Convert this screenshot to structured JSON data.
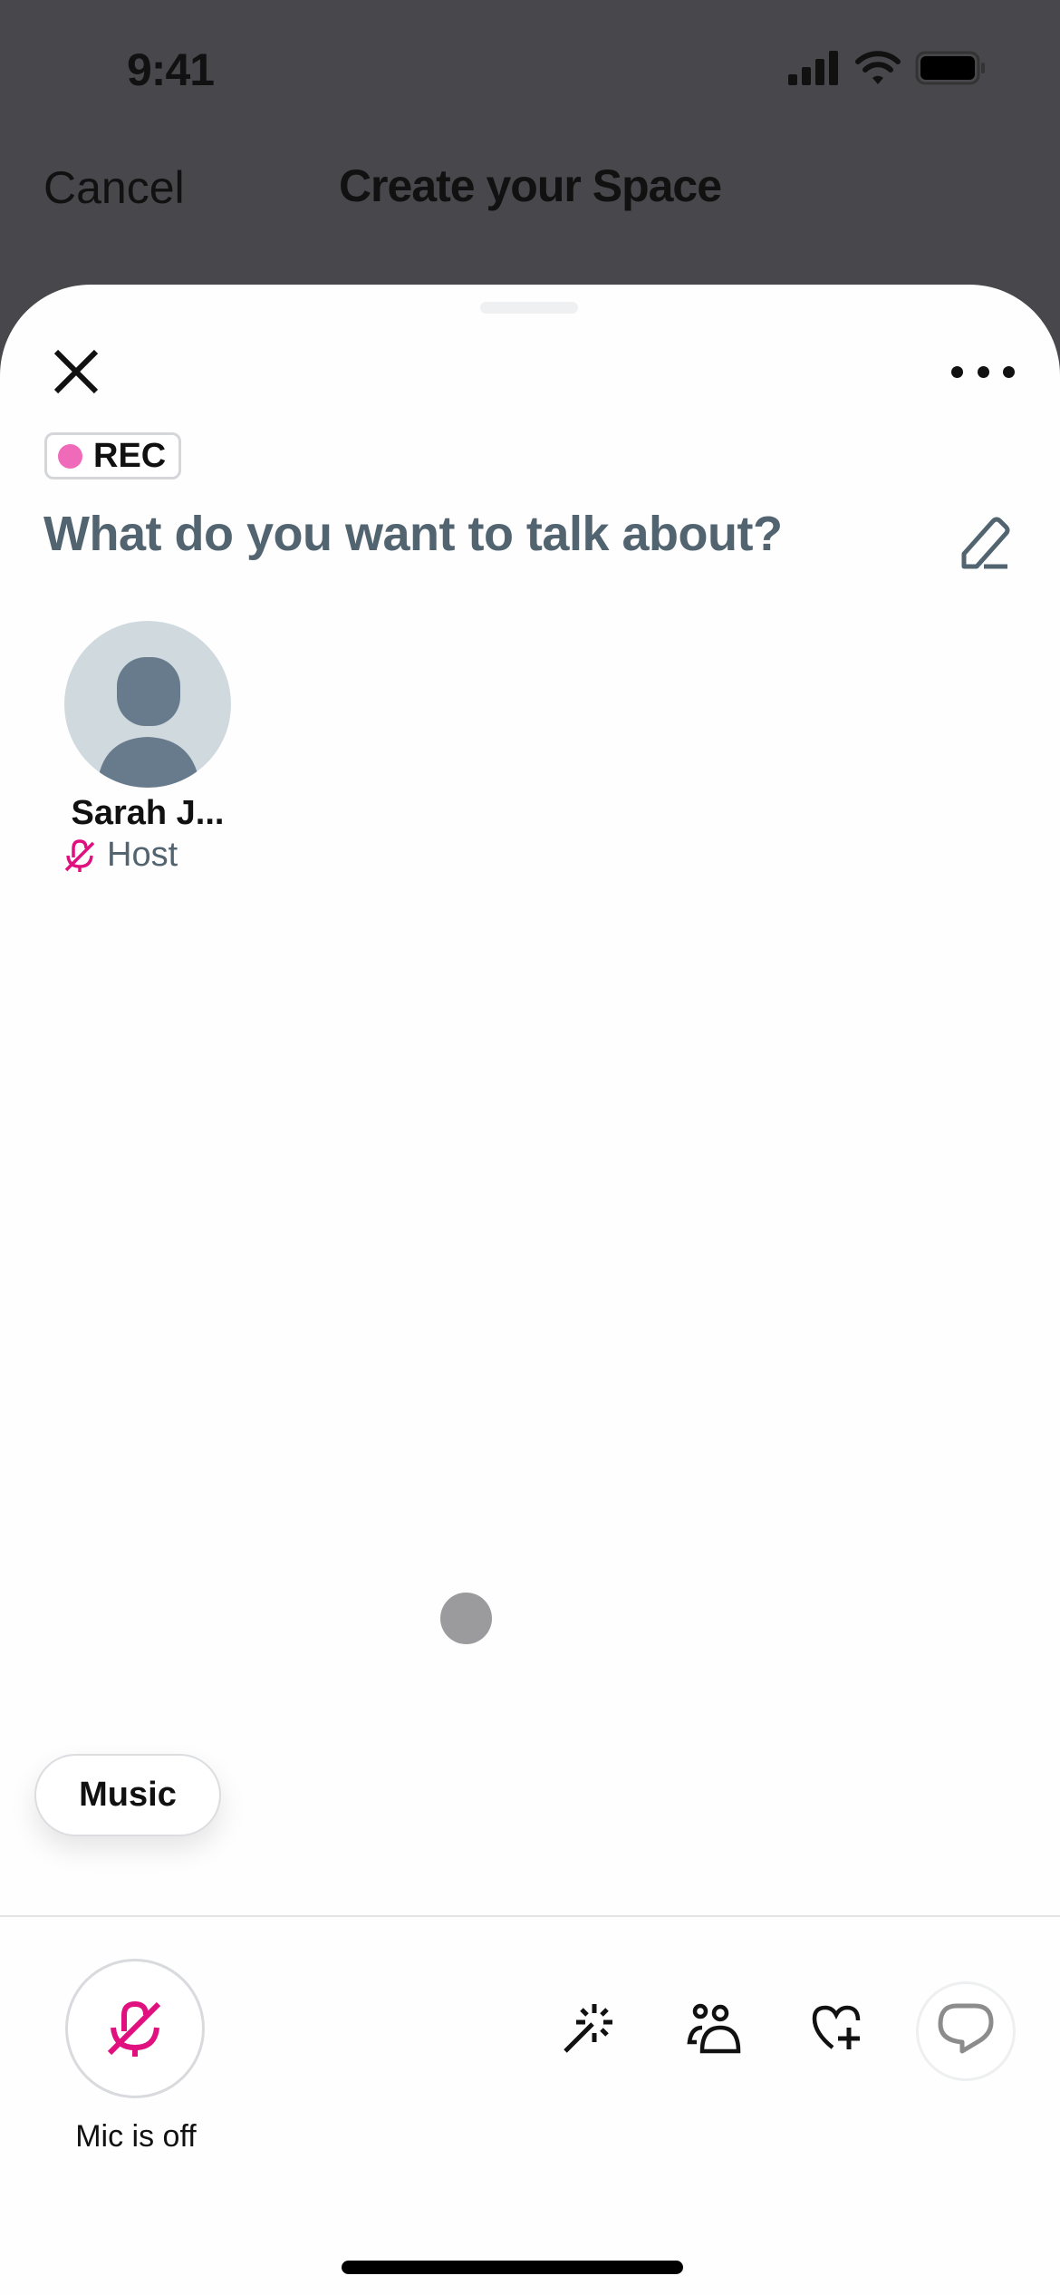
{
  "status_bar": {
    "time": "9:41",
    "icons": [
      "cellular-signal-icon",
      "wifi-icon",
      "battery-icon"
    ]
  },
  "nav": {
    "cancel_label": "Cancel",
    "title": "Create your Space"
  },
  "sheet": {
    "close_icon": "close-icon",
    "more_icon": "more-horizontal-icon",
    "rec_badge": {
      "label": "REC",
      "dot_color": "#f06aba"
    },
    "heading": "What do you want to talk about?",
    "edit_icon": "pencil-icon",
    "participants": [
      {
        "name": "Sarah J...",
        "role": "Host",
        "mic_state": "muted",
        "avatar": "default-avatar"
      }
    ],
    "music_label": "Music"
  },
  "toolbar": {
    "mic_label": "Mic is off",
    "mic_icon": "mic-off-icon",
    "tools": [
      {
        "name": "magic-wand-icon"
      },
      {
        "name": "people-icon"
      },
      {
        "name": "heart-plus-icon"
      },
      {
        "name": "chat-bubble-icon"
      }
    ]
  },
  "colors": {
    "accent": "#e0117f",
    "heading": "#536471",
    "backdrop": "#48474b"
  }
}
